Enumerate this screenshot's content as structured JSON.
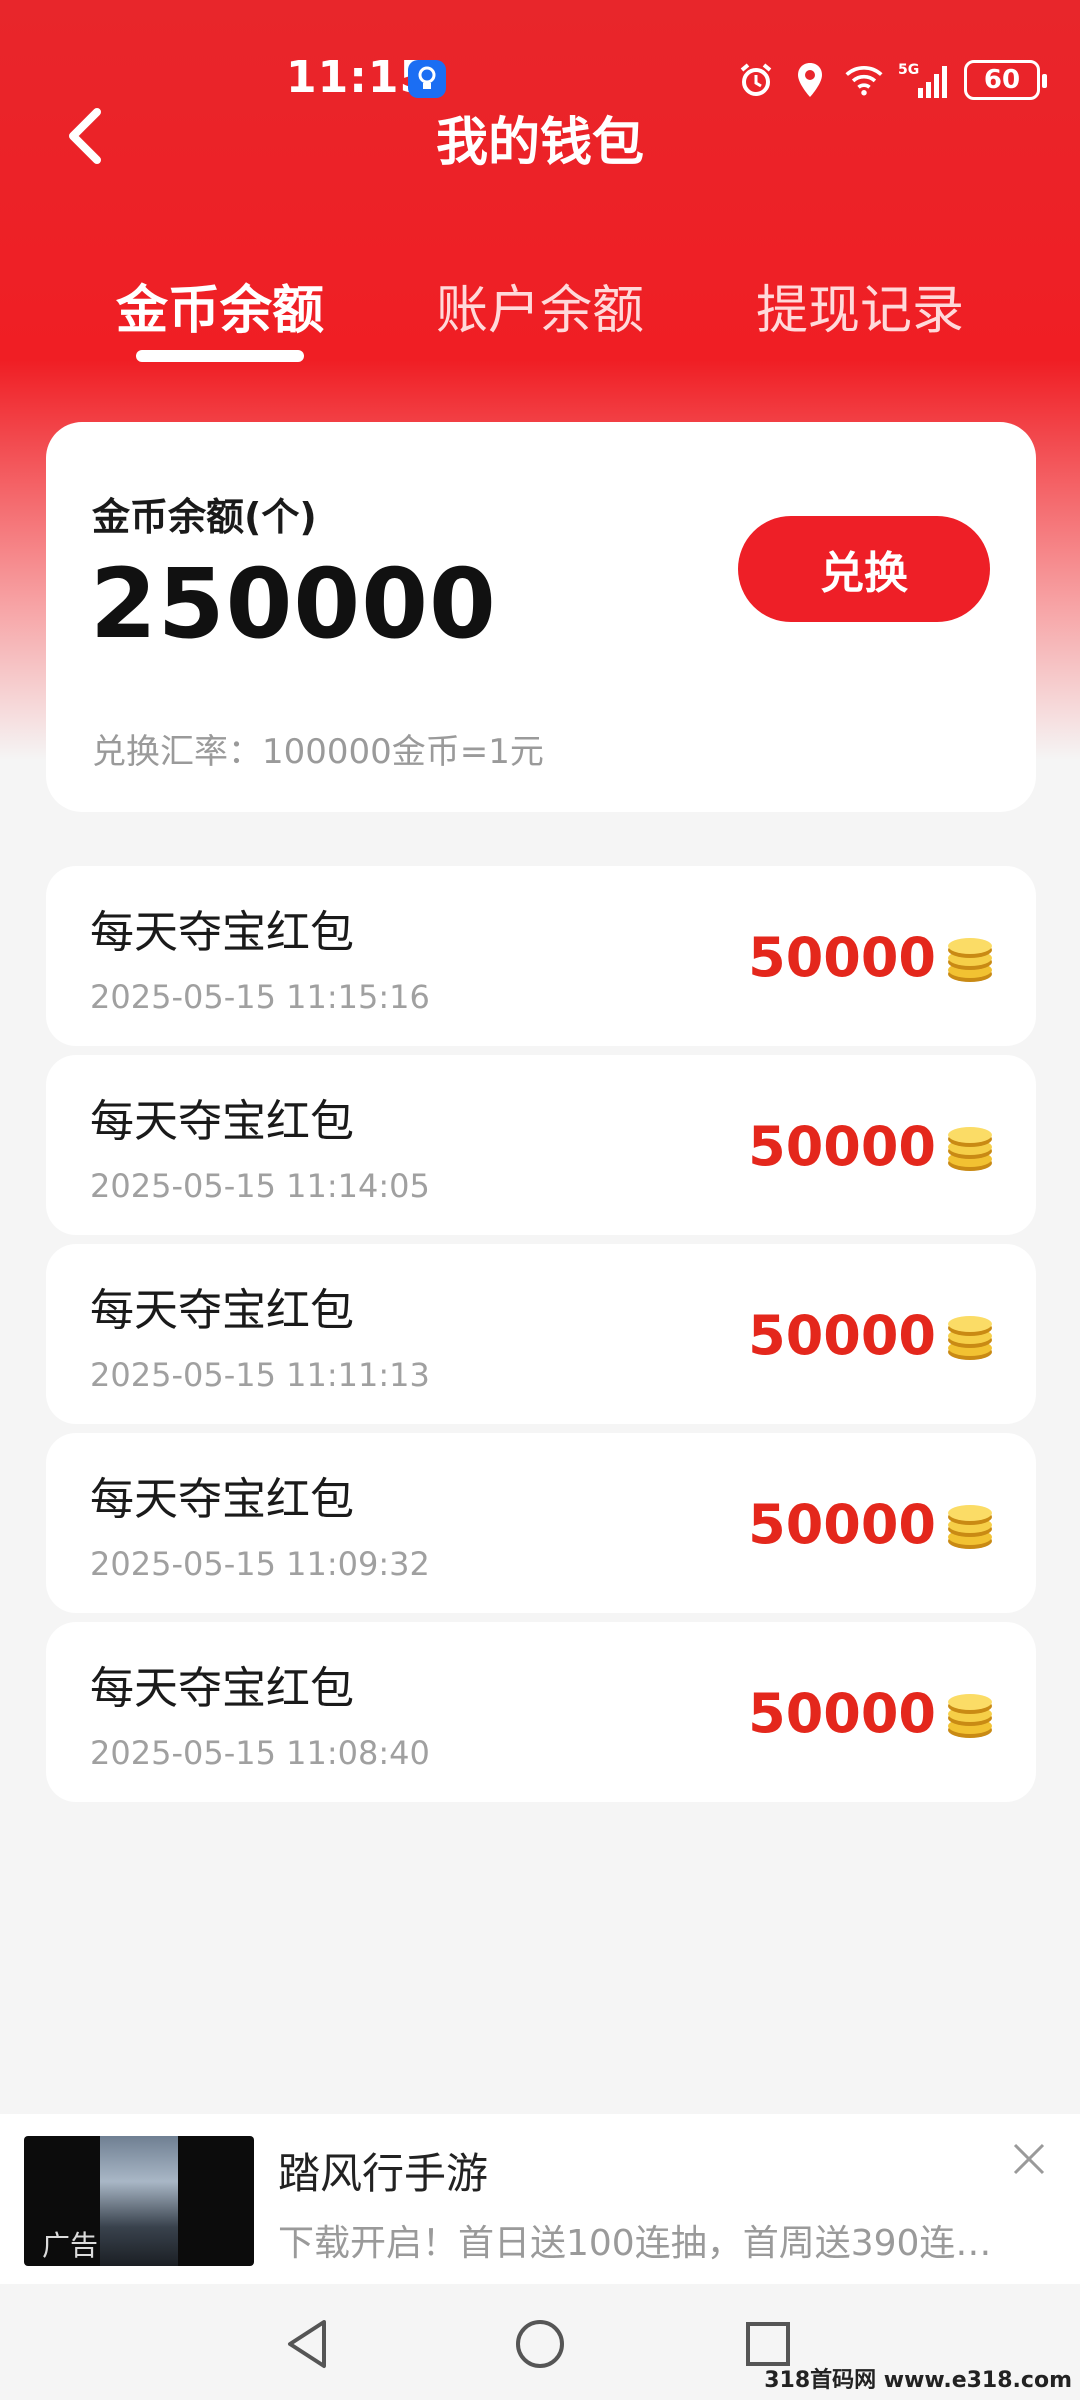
{
  "status_bar": {
    "time": "11:15",
    "battery": "60",
    "icons": [
      "bulb-icon",
      "alarm-icon",
      "location-icon",
      "wifi-icon",
      "5g-signal-icon",
      "battery-icon"
    ]
  },
  "header": {
    "title": "我的钱包"
  },
  "tabs": [
    {
      "label": "金币余额",
      "active": true
    },
    {
      "label": "账户余额",
      "active": false
    },
    {
      "label": "提现记录",
      "active": false
    }
  ],
  "balance_card": {
    "label": "金币余额(个)",
    "amount": "250000",
    "exchange_button": "兑换",
    "rate": "兑换汇率：100000金币=1元"
  },
  "records": [
    {
      "title": "每天夺宝红包",
      "time": "2025-05-15 11:15:16",
      "amount": "50000"
    },
    {
      "title": "每天夺宝红包",
      "time": "2025-05-15 11:14:05",
      "amount": "50000"
    },
    {
      "title": "每天夺宝红包",
      "time": "2025-05-15 11:11:13",
      "amount": "50000"
    },
    {
      "title": "每天夺宝红包",
      "time": "2025-05-15 11:09:32",
      "amount": "50000"
    },
    {
      "title": "每天夺宝红包",
      "time": "2025-05-15 11:08:40",
      "amount": "50000"
    }
  ],
  "ad": {
    "tag": "广告",
    "title": "踏风行手游",
    "desc": "下载开启！首日送100连抽，首周送390连…"
  },
  "watermark": "318首码网 www.e318.com",
  "colors": {
    "brand_red": "#ee1f27",
    "amount_red": "#e4271c",
    "background": "#f5f5f5"
  }
}
